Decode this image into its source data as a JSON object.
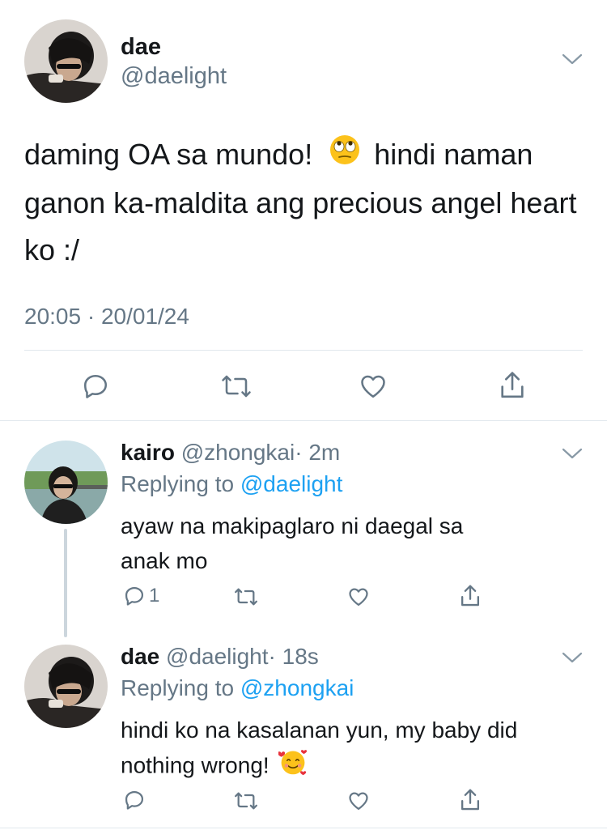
{
  "main_tweet": {
    "display_name": "dae",
    "handle": "@daelight",
    "text_part1": "daming OA sa mundo!",
    "emoji_name": "face-with-rolling-eyes",
    "text_part2": " hindi naman ganon ka-maldita ang precious angel heart ko :/",
    "timestamp": "20:05 · 20/01/24"
  },
  "replies": [
    {
      "display_name": "kairo",
      "handle": "@zhongkai",
      "time": "· 2m",
      "replying_prefix": "Replying to ",
      "replying_to": "@daelight",
      "text": "ayaw na makipaglaro ni daegal sa anak mo",
      "reply_count": "1"
    },
    {
      "display_name": "dae",
      "handle": "@daelight",
      "time": "· 18s",
      "replying_prefix": "Replying to ",
      "replying_to": "@zhongkai",
      "text": "hindi ko na kasalanan yun, my baby did nothing wrong!",
      "emoji_name": "smiling-face-with-hearts"
    }
  ],
  "colors": {
    "text": "#14171a",
    "secondary": "#657786",
    "link": "#1da1f2",
    "divider": "#e1e8ed"
  }
}
